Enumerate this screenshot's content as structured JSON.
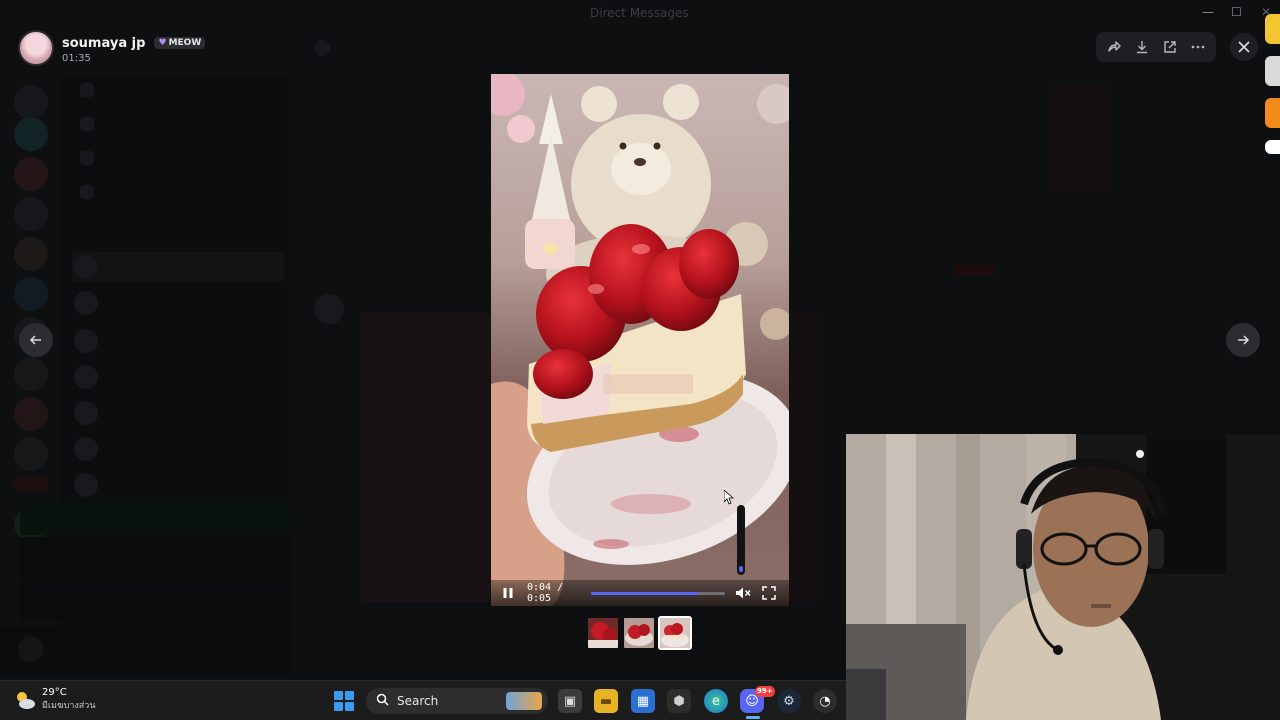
{
  "window": {
    "title": "Direct Messages",
    "minimize_glyph": "—",
    "maximize_glyph": "☐",
    "close_glyph": "✕"
  },
  "viewer": {
    "author_name": "soumaya jp",
    "author_tag": "MEOW",
    "timestamp": "01:35",
    "actions": [
      "forward-icon",
      "download-icon",
      "open-external-icon",
      "more-icon"
    ],
    "close_icon": "close-icon"
  },
  "navigation": {
    "prev_icon": "arrow-left-icon",
    "next_icon": "arrow-right-icon"
  },
  "video": {
    "time_display": "0:04 / 0:05",
    "progress": 0.8,
    "muted": true,
    "volume": 0.1,
    "state": "playing"
  },
  "thumbnails": {
    "count": 3,
    "selected": 3
  },
  "taskbar": {
    "weather_temp": "29°C",
    "weather_desc": "มีเมฆบางส่วน",
    "search_placeholder": "Search",
    "discord_badge": "99+",
    "accent": "#5fb2f2"
  },
  "colors": {
    "discord_blurple": "#5865f2",
    "close_red": "#f23f42"
  }
}
